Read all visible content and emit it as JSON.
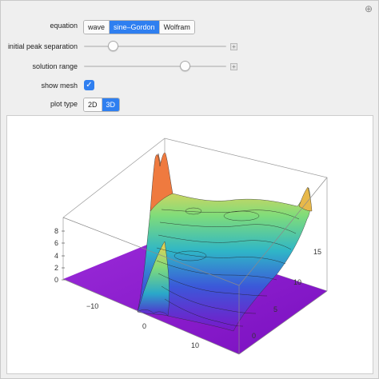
{
  "controls": {
    "equation": {
      "label": "equation",
      "options": [
        "wave",
        "sine–Gordon",
        "Wolfram"
      ],
      "selected": "sine–Gordon"
    },
    "peak_separation": {
      "label": "initial peak separation",
      "value": 0.18
    },
    "solution_range": {
      "label": "solution range",
      "value": 0.73
    },
    "show_mesh": {
      "label": "show mesh",
      "checked": true
    },
    "plot_type": {
      "label": "plot type",
      "options": [
        "2D",
        "3D"
      ],
      "selected": "3D"
    }
  },
  "plot": {
    "z_ticks": [
      "8",
      "6",
      "4",
      "2",
      "0"
    ],
    "x_ticks": [
      "−10",
      "0",
      "10"
    ],
    "y_ticks": [
      "15",
      "10",
      "5",
      "0"
    ],
    "colors": {
      "accent": "#2f7ff0",
      "floor": "#8a1fd1"
    }
  }
}
